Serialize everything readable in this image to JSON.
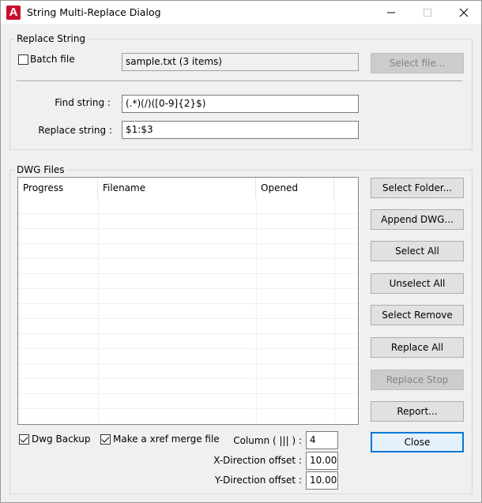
{
  "window": {
    "title": "String Multi-Replace Dialog",
    "app_icon_letter": "A",
    "minimize_glyph": "—",
    "maximize_glyph": "☐",
    "close_glyph": "✕"
  },
  "replace_group": {
    "label": "Replace String",
    "batch_file_label": "Batch file",
    "batch_file_checked": false,
    "batch_file_value": "sample.txt (3 items)",
    "select_file_button": "Select file...",
    "find_label": "Find string :",
    "find_value": "(.*)(/)([0-9]{2}$)",
    "replace_label": "Replace string :",
    "replace_value": "$1:$3"
  },
  "dwg_group": {
    "label": "DWG Files",
    "columns": [
      "Progress",
      "Filename",
      "Opened"
    ],
    "rows": []
  },
  "buttons": {
    "select_folder": "Select Folder...",
    "append_dwg": "Append DWG...",
    "select_all": "Select All",
    "unselect_all": "Unselect All",
    "select_remove": "Select Remove",
    "replace_all": "Replace All",
    "replace_stop": "Replace Stop",
    "report": "Report...",
    "close": "Close"
  },
  "options": {
    "dwg_backup_label": "Dwg Backup",
    "dwg_backup_checked": true,
    "xref_merge_label": "Make a xref merge file",
    "xref_merge_checked": true,
    "column_label": "Column ( ||| ) :",
    "column_value": "4",
    "x_offset_label": "X-Direction offset :",
    "x_offset_value": "10.000",
    "y_offset_label": "Y-Direction offset :",
    "y_offset_value": "10.000"
  },
  "colors": {
    "accent": "#0078d7",
    "app_icon": "#c8102e"
  }
}
